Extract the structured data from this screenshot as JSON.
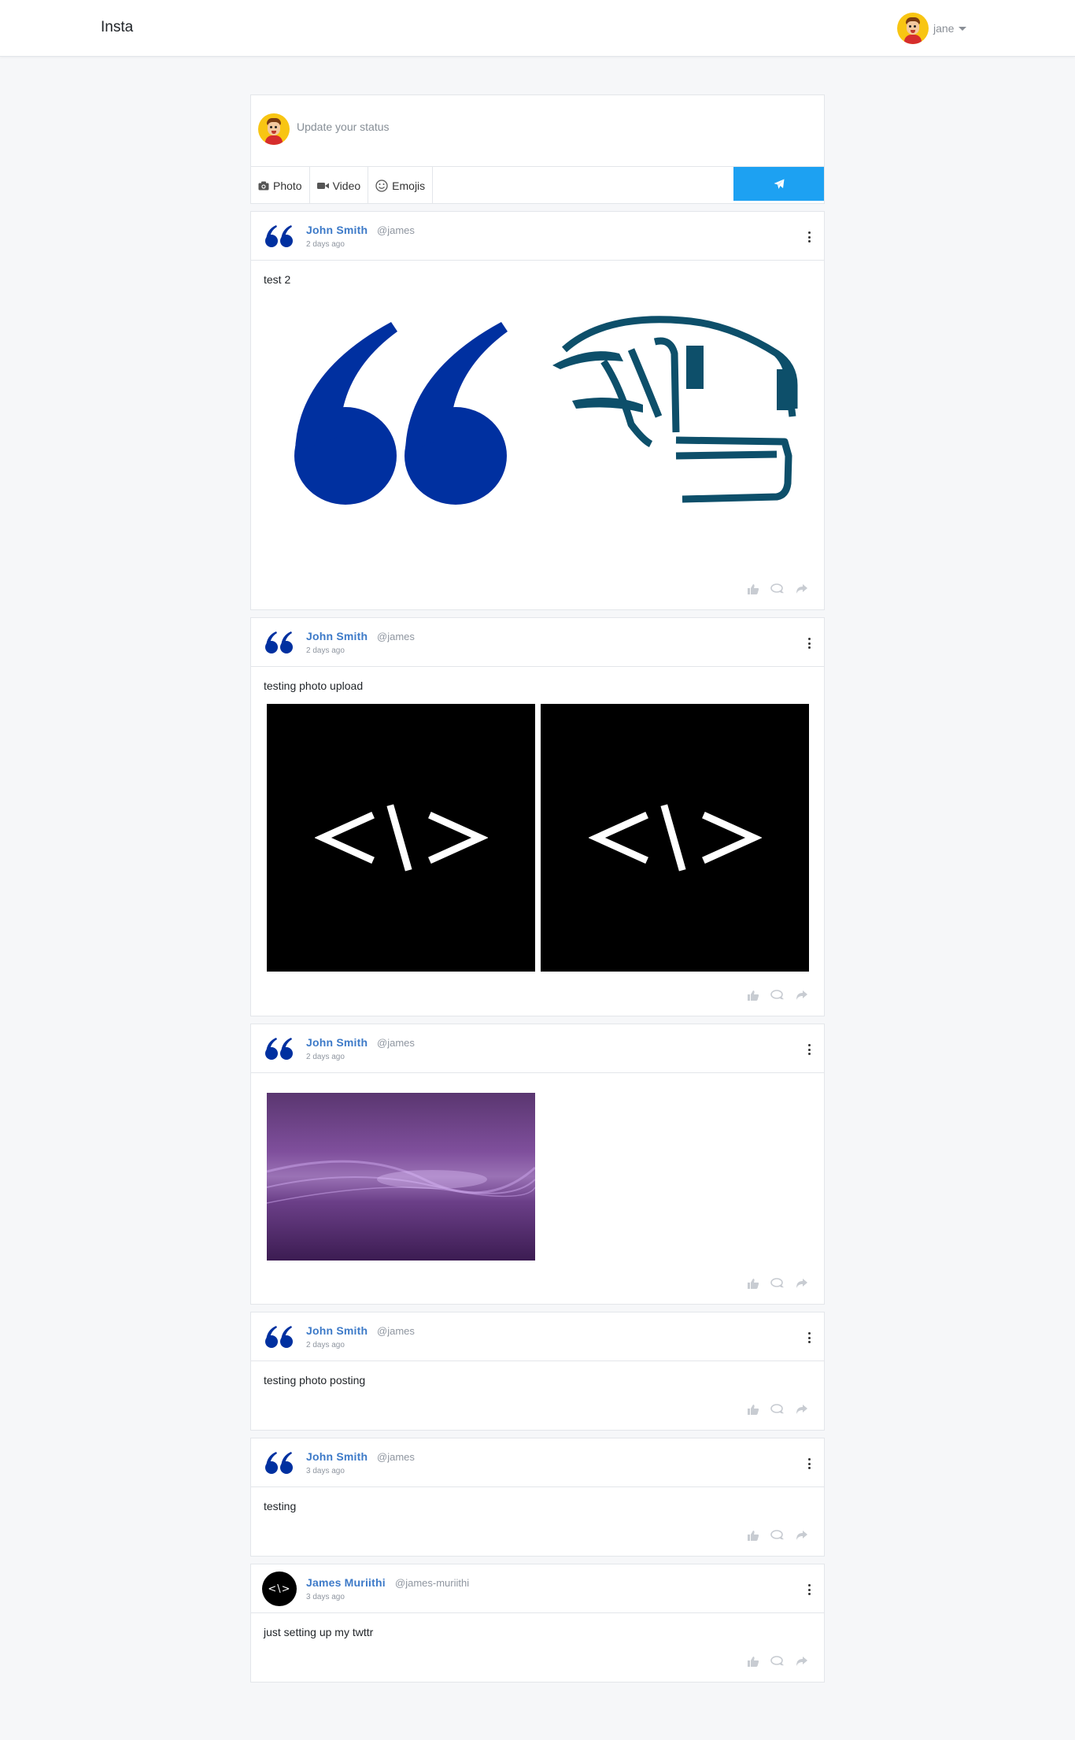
{
  "navbar": {
    "brand": "Insta",
    "user": {
      "name": "jane",
      "avatar_icon": "cartoon-avatar"
    }
  },
  "composer": {
    "placeholder": "Update your status",
    "tools": [
      {
        "label": "Photo",
        "icon": "camera-icon"
      },
      {
        "label": "Video",
        "icon": "video-icon"
      },
      {
        "label": "Emojis",
        "icon": "smiley-icon"
      }
    ],
    "send_icon": "paper-plane-icon",
    "send_color": "#1da1f2"
  },
  "posts": [
    {
      "author": "John Smith",
      "handle": "@james",
      "time": "2 days ago",
      "text": "test 2",
      "avatar": "quote-icon",
      "images": [
        "quote-marks-image",
        "bus-logo-image"
      ]
    },
    {
      "author": "John Smith",
      "handle": "@james",
      "time": "2 days ago",
      "text": "testing photo upload",
      "avatar": "quote-icon",
      "images": [
        "code-logo-image",
        "code-logo-image"
      ]
    },
    {
      "author": "John Smith",
      "handle": "@james",
      "time": "2 days ago",
      "text": "",
      "avatar": "quote-icon",
      "images": [
        "purple-wallpaper-image"
      ]
    },
    {
      "author": "John Smith",
      "handle": "@james",
      "time": "2 days ago",
      "text": "testing photo posting",
      "avatar": "quote-icon",
      "images": []
    },
    {
      "author": "John Smith",
      "handle": "@james",
      "time": "3 days ago",
      "text": "testing",
      "avatar": "quote-icon",
      "images": []
    },
    {
      "author": "James Muriithi",
      "handle": "@james-muriithi",
      "time": "3 days ago",
      "text": "just setting up my twttr",
      "avatar": "code-icon",
      "images": []
    }
  ],
  "code_logo_text": "<\\>",
  "colors": {
    "accent": "#1da1f2",
    "author": "#3d7ac8",
    "quote_blue": "#0030a0",
    "bus_teal": "#0d4f6a"
  }
}
